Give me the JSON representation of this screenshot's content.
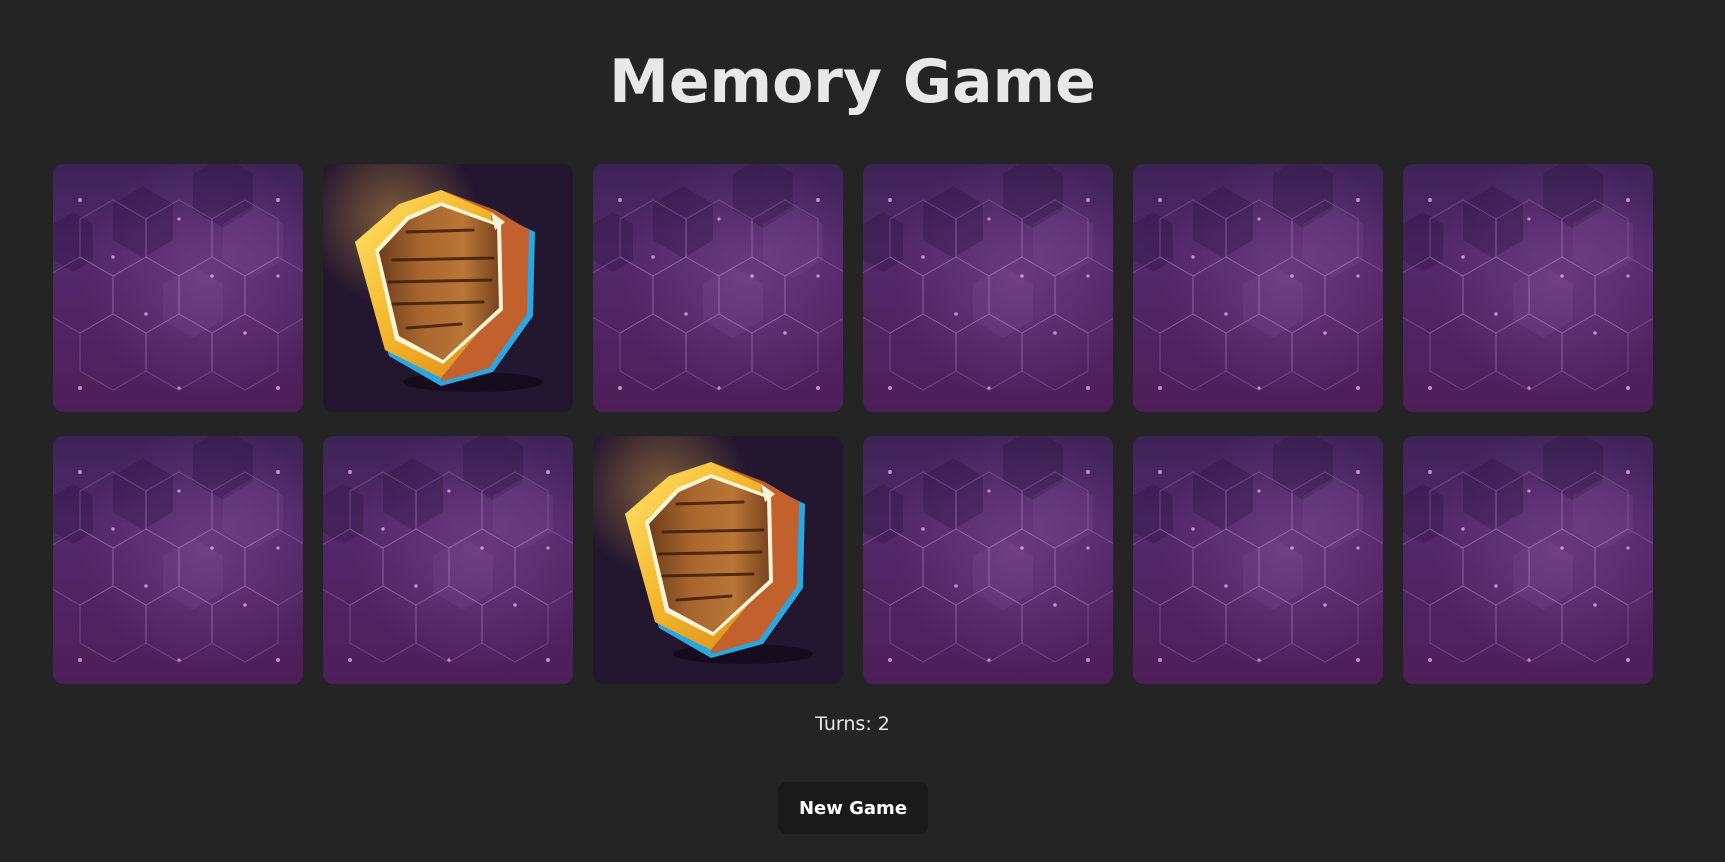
{
  "title": "Memory Game",
  "turns_label": "Turns: 2",
  "new_game_label": "New Game",
  "colors": {
    "background": "#242424",
    "card_back": "#5a2a66",
    "card_front_bg": "#22172f"
  },
  "cards": [
    {
      "face": "down",
      "icon": null
    },
    {
      "face": "up",
      "icon": "wooden-shield-icon"
    },
    {
      "face": "down",
      "icon": null
    },
    {
      "face": "down",
      "icon": null
    },
    {
      "face": "down",
      "icon": null
    },
    {
      "face": "down",
      "icon": null
    },
    {
      "face": "down",
      "icon": null
    },
    {
      "face": "down",
      "icon": null
    },
    {
      "face": "up",
      "icon": "wooden-shield-icon"
    },
    {
      "face": "down",
      "icon": null
    },
    {
      "face": "down",
      "icon": null
    },
    {
      "face": "down",
      "icon": null
    }
  ]
}
